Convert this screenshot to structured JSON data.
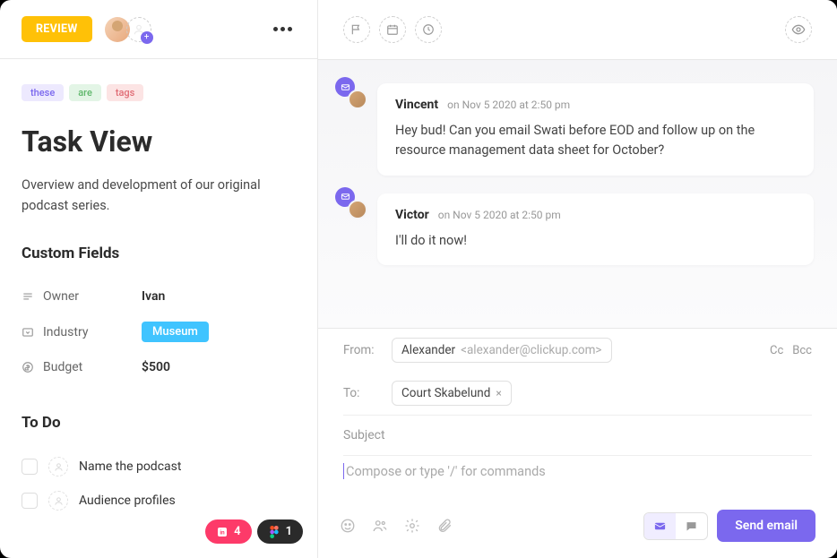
{
  "header": {
    "status": "REVIEW"
  },
  "tags": [
    {
      "label": "these",
      "color": "purple"
    },
    {
      "label": "are",
      "color": "green"
    },
    {
      "label": "tags",
      "color": "pink"
    }
  ],
  "task": {
    "title": "Task View",
    "description": "Overview and development of our original podcast series."
  },
  "custom_fields": {
    "heading": "Custom Fields",
    "rows": [
      {
        "label": "Owner",
        "value": "Ivan",
        "type": "text"
      },
      {
        "label": "Industry",
        "value": "Museum",
        "type": "pill"
      },
      {
        "label": "Budget",
        "value": "$500",
        "type": "text"
      }
    ]
  },
  "todo": {
    "heading": "To Do",
    "items": [
      {
        "label": "Name the podcast"
      },
      {
        "label": "Audience profiles"
      }
    ]
  },
  "footer_pills": [
    {
      "count": "4",
      "color": "pink"
    },
    {
      "count": "1",
      "color": "dark"
    }
  ],
  "comments": [
    {
      "author": "Vincent",
      "time": "on Nov 5 2020 at 2:50 pm",
      "body": "Hey bud! Can you email Swati before EOD and follow up on the resource management data sheet for October?"
    },
    {
      "author": "Victor",
      "time": "on Nov 5 2020 at 2:50 pm",
      "body": "I'll do it now!"
    }
  ],
  "compose": {
    "from_label": "From:",
    "from_name": "Alexander",
    "from_email": "<alexander@clickup.com>",
    "to_label": "To:",
    "to_chip": "Court Skabelund",
    "cc": "Cc",
    "bcc": "Bcc",
    "subject_placeholder": "Subject",
    "body_placeholder": "Compose or type '/' for commands",
    "send_label": "Send email"
  }
}
